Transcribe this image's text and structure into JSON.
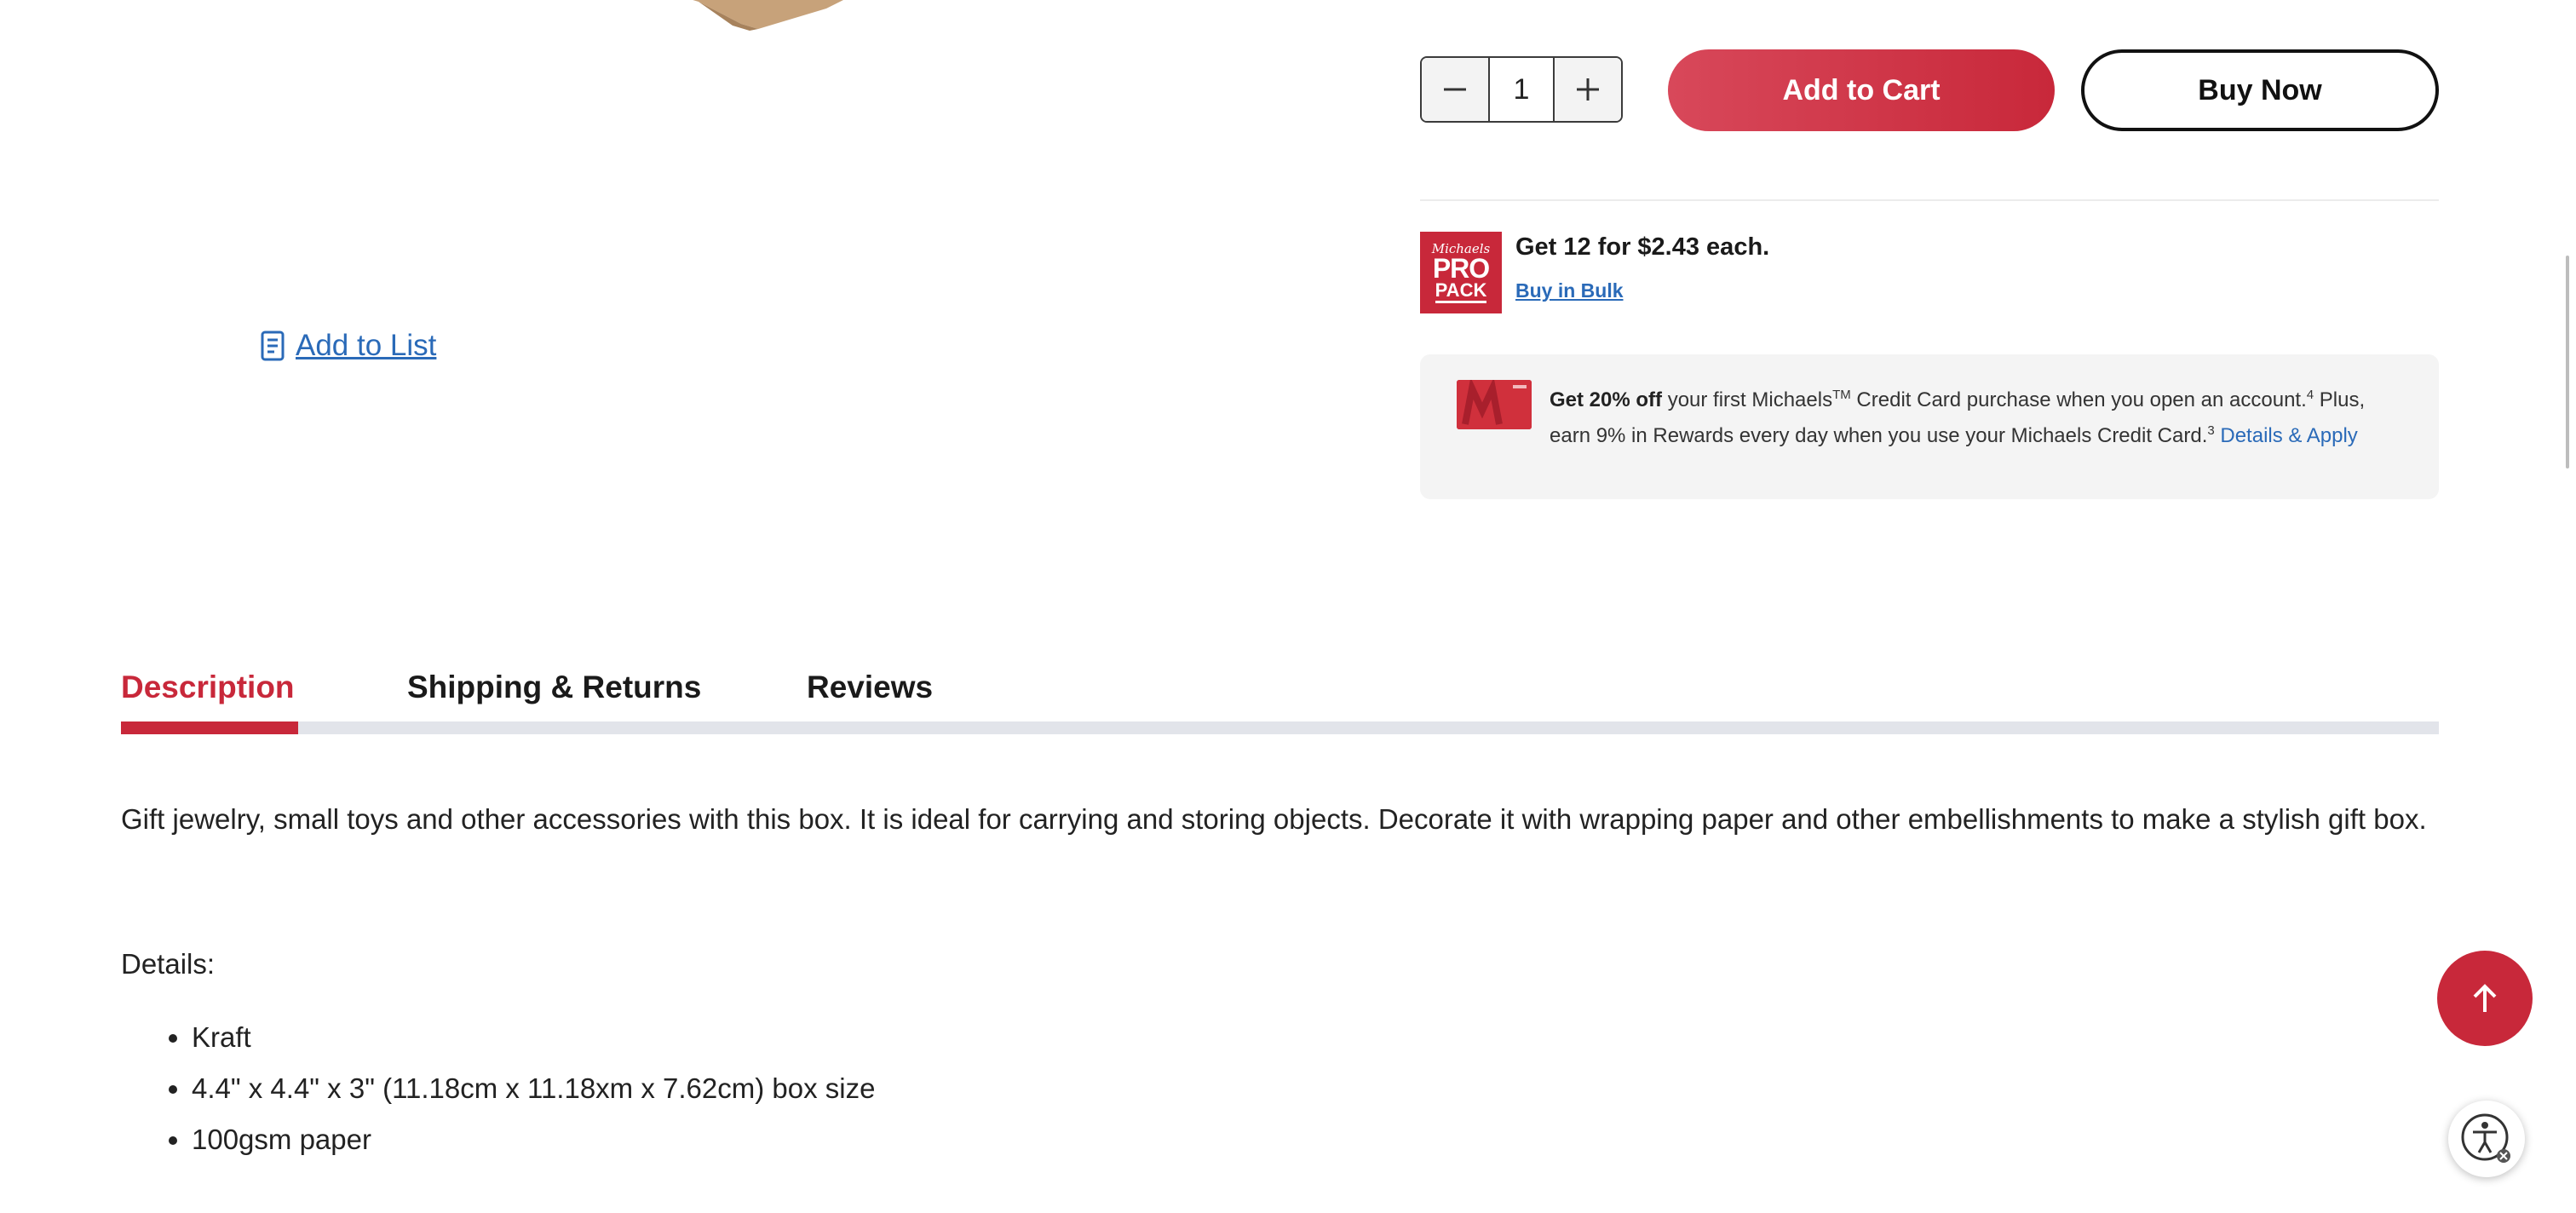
{
  "purchase": {
    "quantity_value": "1",
    "add_to_cart_label": "Add to Cart",
    "buy_now_label": "Buy Now"
  },
  "pro_pack": {
    "logo_line1": "Michaels",
    "logo_line2": "PRO",
    "logo_line3": "PACK",
    "offer_text": "Get 12 for $2.43 each.",
    "bulk_link": "Buy in Bulk"
  },
  "list": {
    "add_to_list_label": "Add to List"
  },
  "credit_promo": {
    "bold_lead": "Get 20% off",
    "text1": " your first Michaels",
    "tm": "TM",
    "text2": " Credit Card purchase when you open an account.",
    "sup1": "4",
    "text3": " Plus, earn 9% in Rewards every day when you use your Michaels Credit Card.",
    "sup2": "3",
    "details_link": "Details & Apply"
  },
  "tabs": [
    {
      "label": "Description",
      "active": true
    },
    {
      "label": "Shipping & Returns",
      "active": false
    },
    {
      "label": "Reviews",
      "active": false
    }
  ],
  "description": {
    "paragraph": "Gift jewelry, small toys and other accessories with this box. It is ideal for carrying and storing objects. Decorate it with wrapping paper and other embellishments to make a stylish gift box.",
    "details_heading": "Details:",
    "bullets": [
      "Kraft",
      "4.4\" x 4.4\" x 3\" (11.18cm x 11.18xm x 7.62cm) box size",
      "100gsm paper"
    ]
  },
  "colors": {
    "brand_red": "#c8283a",
    "link_blue": "#2a6ab8",
    "tab_track": "#e2e4ea"
  },
  "icons": {
    "minus": "minus-icon",
    "plus": "plus-icon",
    "list": "list-document-icon",
    "back_to_top": "arrow-up-icon",
    "accessibility": "accessibility-icon"
  }
}
